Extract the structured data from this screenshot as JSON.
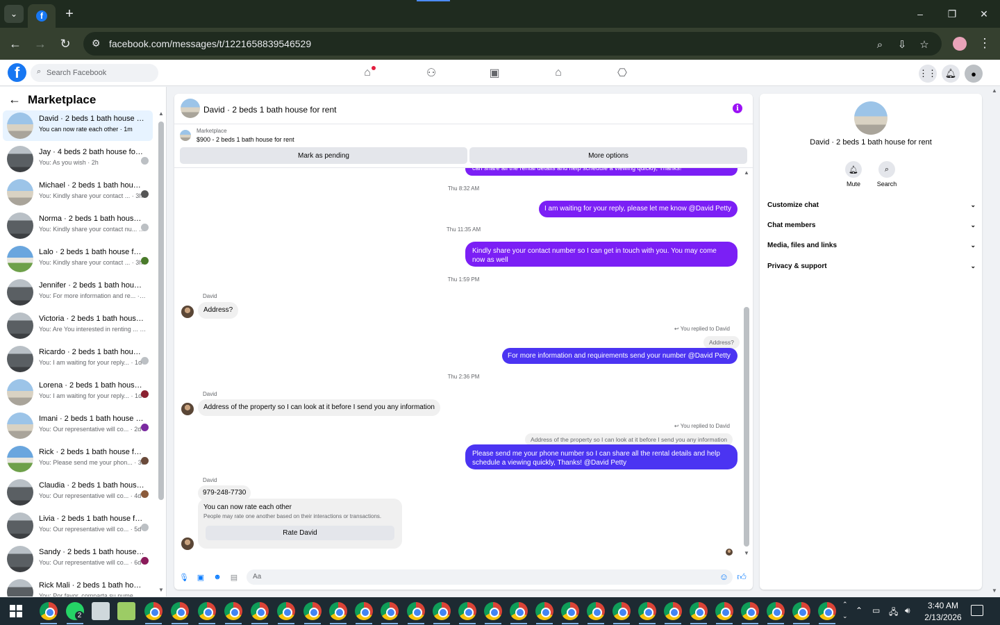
{
  "browser": {
    "url": "facebook.com/messages/t/1221658839546529",
    "new_tab": "+",
    "window_controls": [
      "–",
      "❐",
      "✕"
    ]
  },
  "fb": {
    "logo": "f",
    "search_placeholder": "Search Facebook",
    "nav_icons": [
      "home-icon",
      "friends-icon",
      "video-icon",
      "marketplace-icon",
      "gaming-icon"
    ],
    "right_icons": [
      "menu-grid-icon",
      "bell-icon",
      "account-icon"
    ]
  },
  "left": {
    "title": "Marketplace",
    "conversations": [
      {
        "name": "David · 2 beds 1 bath house for rent",
        "snippet": "You can now rate each other · 1m",
        "active": true
      },
      {
        "name": "Jay · 4 beds 2 bath house for rent",
        "snippet": "You: As you wish · 2h"
      },
      {
        "name": "Michael · 2 beds 1 bath house for rent",
        "snippet": "You: Kindly share your contact ... · 3h"
      },
      {
        "name": "Norma · 2 beds 1 bath house for rent",
        "snippet": "You: Kindly share your contact nu... · 3h"
      },
      {
        "name": "Lalo · 2 beds 1 bath house for rent",
        "snippet": "You: Kindly share your contact ... · 3h"
      },
      {
        "name": "Jennifer · 2 beds 1 bath house for rent",
        "snippet": "You: For more information and re... · 6h"
      },
      {
        "name": "Victoria · 2 beds 1 bath house for rent",
        "snippet": "You: Are You interested in renting ... · 8h"
      },
      {
        "name": "Ricardo · 2 beds 1 bath house for rent",
        "snippet": "You: I am waiting for your reply... · 1d"
      },
      {
        "name": "Lorena · 2 beds 1 bath house for rent",
        "snippet": "You: I am waiting for your reply... · 1d"
      },
      {
        "name": "Imani · 2 beds 1 bath house for rent",
        "snippet": "You: Our representative will co... · 2d"
      },
      {
        "name": "Rick · 2 beds 1 bath house for rent",
        "snippet": "You: Please send me your phon... · 3d"
      },
      {
        "name": "Claudia · 2 beds 1 bath house for rent",
        "snippet": "You: Our representative will co... · 4d"
      },
      {
        "name": "Livia · 2 beds 1 bath house for rent",
        "snippet": "You: Our representative will co... · 5d"
      },
      {
        "name": "Sandy · 2 beds 1 bath house for rent",
        "snippet": "You: Our representative will co... · 6d"
      },
      {
        "name": "Rick Mali · 2 beds 1 bath house for rent",
        "snippet": "You: Por favor, comparta su nume... · 6d"
      }
    ]
  },
  "chat": {
    "title": "David · 2 beds 1 bath house for rent",
    "marketplace_label": "Marketplace",
    "listing": "$900 - 2 beds 1 bath house for rent",
    "mark_pending": "Mark as pending",
    "more_options": "More options",
    "cut_message": "can share all the rental details and help schedule a viewing quickly, Thanks!",
    "ts1": "Thu 8:32 AM",
    "msg1": "I am waiting for your reply, please let me know @David Petty",
    "ts2": "Thu 11:35 AM",
    "msg2": "Kindly share your contact number so I can get in touch with you. You may come now as well",
    "ts3": "Thu 1:59 PM",
    "sender": "David",
    "msg3": "Address?",
    "replied1": "You replied to David",
    "quote1": "Address?",
    "msg4": "For more information and requirements send your number @David Petty",
    "ts4": "Thu 2:36 PM",
    "msg5": "Address of the property so I can look at it before I send you any information",
    "replied2": "You replied to David",
    "quote2": "Address of the property so I can look at it before I send you any information",
    "msg6": "Please send me your phone number so I can share all the rental details and help schedule a viewing quickly, Thanks! @David Petty",
    "msg7": "979-248-7730",
    "rate_title": "You can now rate each other",
    "rate_desc": "People may rate one another based on their interactions or transactions.",
    "rate_button": "Rate David",
    "composer_placeholder": "Aa"
  },
  "right": {
    "title": "David · 2 beds 1 bath house for rent",
    "mute": "Mute",
    "search": "Search",
    "items": [
      "Customize chat",
      "Chat members",
      "Media, files and links",
      "Privacy & support"
    ]
  },
  "taskbar": {
    "time": "3:40 AM",
    "date": "2/13/2026",
    "whatsapp_badge": "2"
  },
  "colors": {
    "messenger_purple": "#7b1ff5",
    "messenger_blue": "#4b34f2",
    "fb_blue": "#1877f2"
  }
}
